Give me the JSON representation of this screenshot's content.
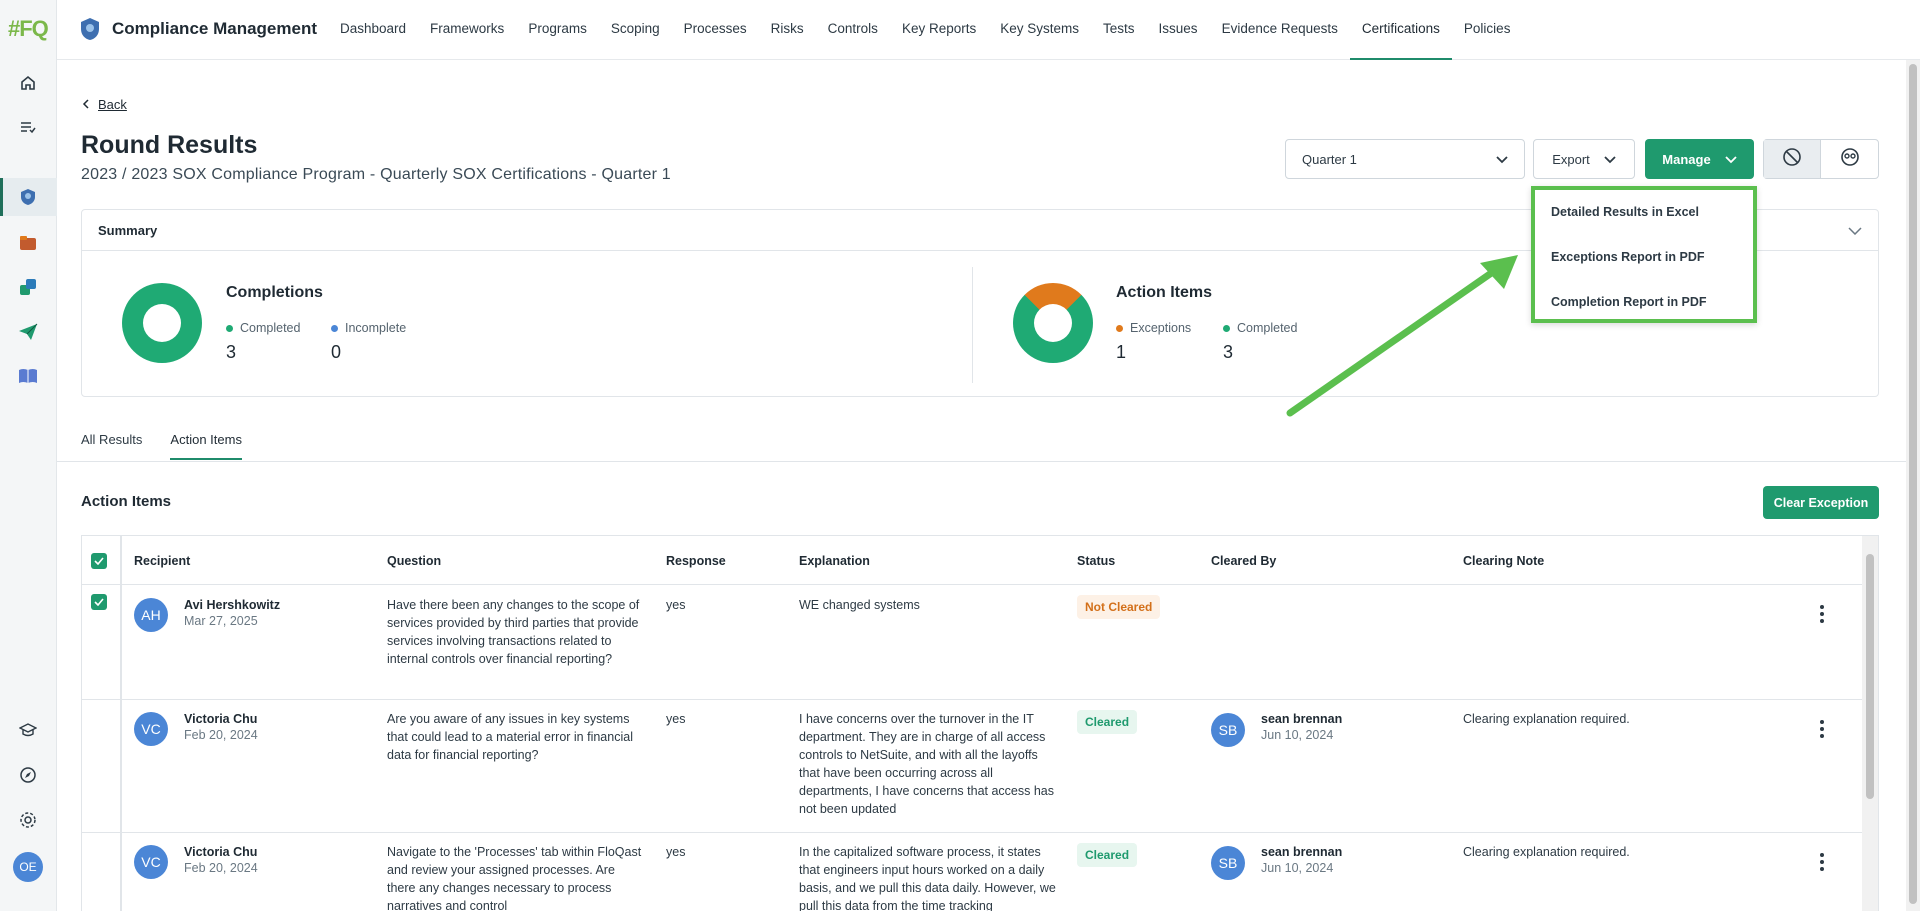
{
  "app": {
    "logo": "#FQ",
    "title": "Compliance Management"
  },
  "nav": [
    "Dashboard",
    "Frameworks",
    "Programs",
    "Scoping",
    "Processes",
    "Risks",
    "Controls",
    "Key Reports",
    "Key Systems",
    "Tests",
    "Issues",
    "Evidence Requests",
    "Certifications",
    "Policies"
  ],
  "nav_active": "Certifications",
  "rail": {
    "avatar": "OE"
  },
  "header": {
    "back": "Back",
    "title": "Round Results",
    "subtitle": "2023 / 2023 SOX Compliance Program - Quarterly SOX Certifications - Quarter 1",
    "quarter_select": "Quarter 1",
    "export_label": "Export",
    "manage_label": "Manage"
  },
  "summary": {
    "title": "Summary",
    "completions": {
      "title": "Completions",
      "legend1": "Completed",
      "legend2": "Incomplete",
      "value1": "3",
      "value2": "0"
    },
    "action_items": {
      "title": "Action Items",
      "legend1": "Exceptions",
      "legend2": "Completed",
      "value1": "1",
      "value2": "3"
    }
  },
  "dropdown": [
    "Detailed Results in Excel",
    "Exceptions Report in PDF",
    "Completion Report in PDF"
  ],
  "tabs": [
    "All Results",
    "Action Items"
  ],
  "section": {
    "title": "Action Items",
    "clear_button": "Clear Exception"
  },
  "table": {
    "headers": [
      "Recipient",
      "Question",
      "Response",
      "Explanation",
      "Status",
      "Cleared By",
      "Clearing Note"
    ],
    "rows": [
      {
        "initials": "AH",
        "name": "Avi Hershkowitz",
        "date": "Mar 27, 2025",
        "question": "Have there been any changes to the scope of services provided by third parties that provide services involving transactions related to internal controls over financial reporting?",
        "response": "yes",
        "explanation": "WE changed systems",
        "status": "Not Cleared",
        "cleared_by": "",
        "cleared_initials": "",
        "cleared_date": "",
        "note": ""
      },
      {
        "initials": "VC",
        "name": "Victoria Chu",
        "date": "Feb 20, 2024",
        "question": "Are you aware of any issues in key systems that could lead to a material error in financial data for financial reporting?",
        "response": "yes",
        "explanation": "I have concerns over the turnover in the IT department. They are in charge of all access controls to NetSuite, and with all the layoffs that have been occurring across all departments, I have concerns that access has not been updated",
        "status": "Cleared",
        "cleared_by": "sean brennan",
        "cleared_initials": "SB",
        "cleared_date": "Jun 10, 2024",
        "note": "Clearing explanation required."
      },
      {
        "initials": "VC",
        "name": "Victoria Chu",
        "date": "Feb 20, 2024",
        "question": "Navigate to the 'Processes' tab within FloQast and review your assigned processes. Are there any changes necessary to process narratives and control",
        "response": "yes",
        "explanation": "In the capitalized software process, it states that engineers input hours worked on a daily basis, and we pull this data daily. However, we pull this data from the time tracking",
        "status": "Cleared",
        "cleared_by": "sean brennan",
        "cleared_initials": "SB",
        "cleared_date": "Jun 10, 2024",
        "note": "Clearing explanation required."
      }
    ]
  },
  "colors": {
    "accent": "#1f9a6e",
    "exception": "#e07a1c",
    "highlight": "#5bbf4e",
    "avatar": "#4b86d6"
  }
}
